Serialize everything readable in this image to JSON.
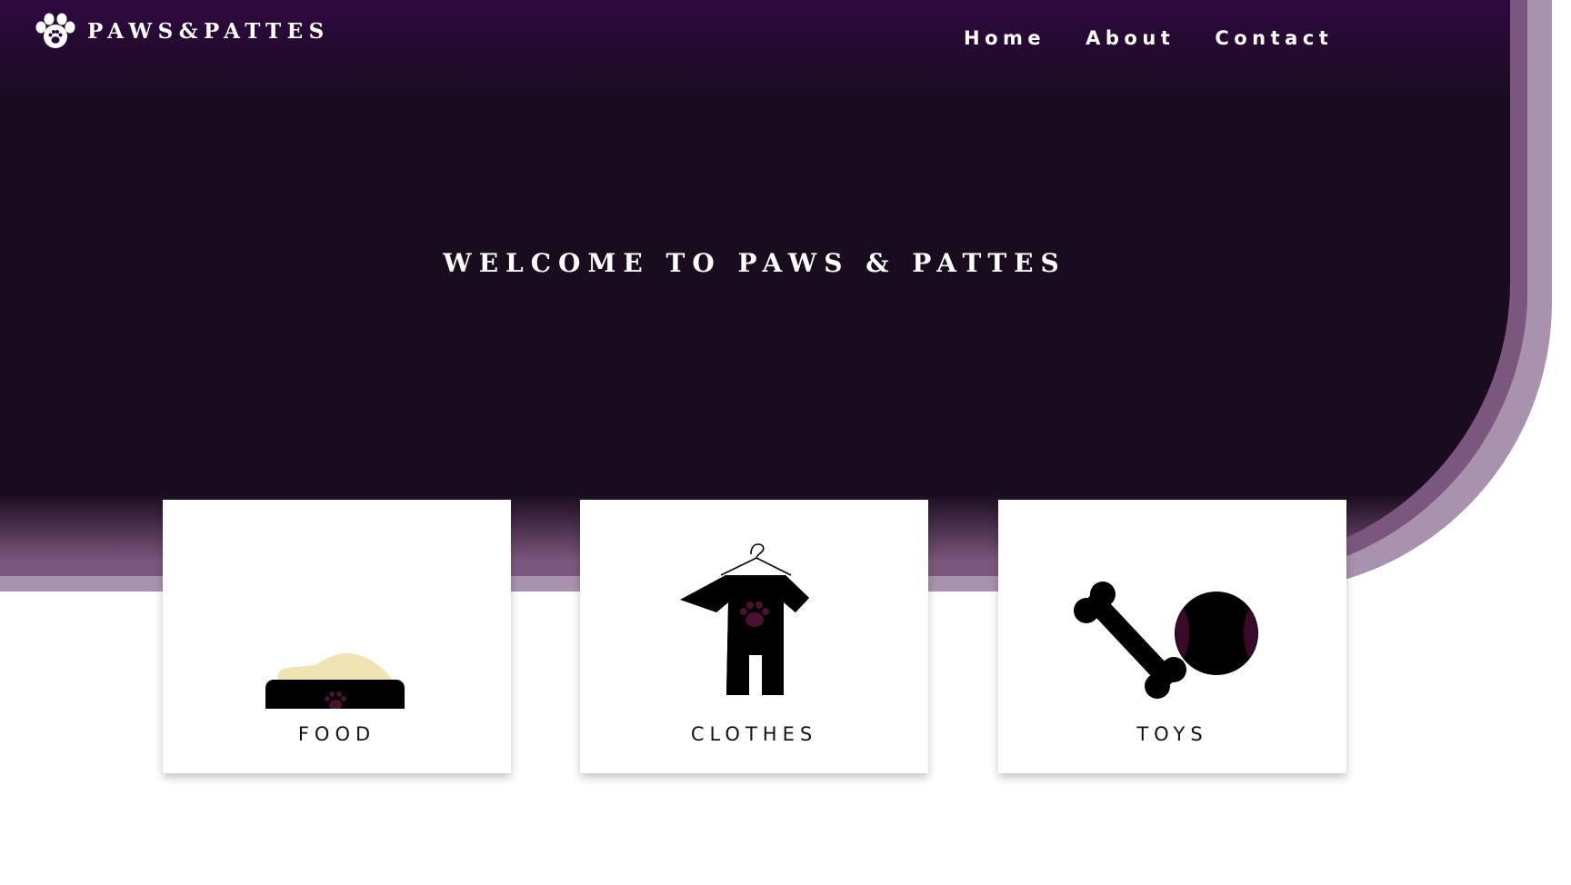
{
  "colors": {
    "hero_dark": "#1a0c1f",
    "hero_top": "#2e0940",
    "accent_purple": "#7c577d",
    "accent_lavender": "#a892ad",
    "paw_accent": "#4a1230",
    "food_cream": "#ede3b3",
    "card_bg": "#ffffff"
  },
  "header": {
    "brand": "PAWS&PATTES",
    "logo_icon": "paw-print-icon",
    "nav": [
      {
        "label": "Home"
      },
      {
        "label": "About"
      },
      {
        "label": "Contact"
      }
    ]
  },
  "hero": {
    "title": "WELCOME TO PAWS & PATTES"
  },
  "categories": [
    {
      "label": "FOOD",
      "icon": "food-bowl-icon"
    },
    {
      "label": "CLOTHES",
      "icon": "pet-clothes-icon"
    },
    {
      "label": "TOYS",
      "icon": "bone-and-ball-icon"
    }
  ]
}
